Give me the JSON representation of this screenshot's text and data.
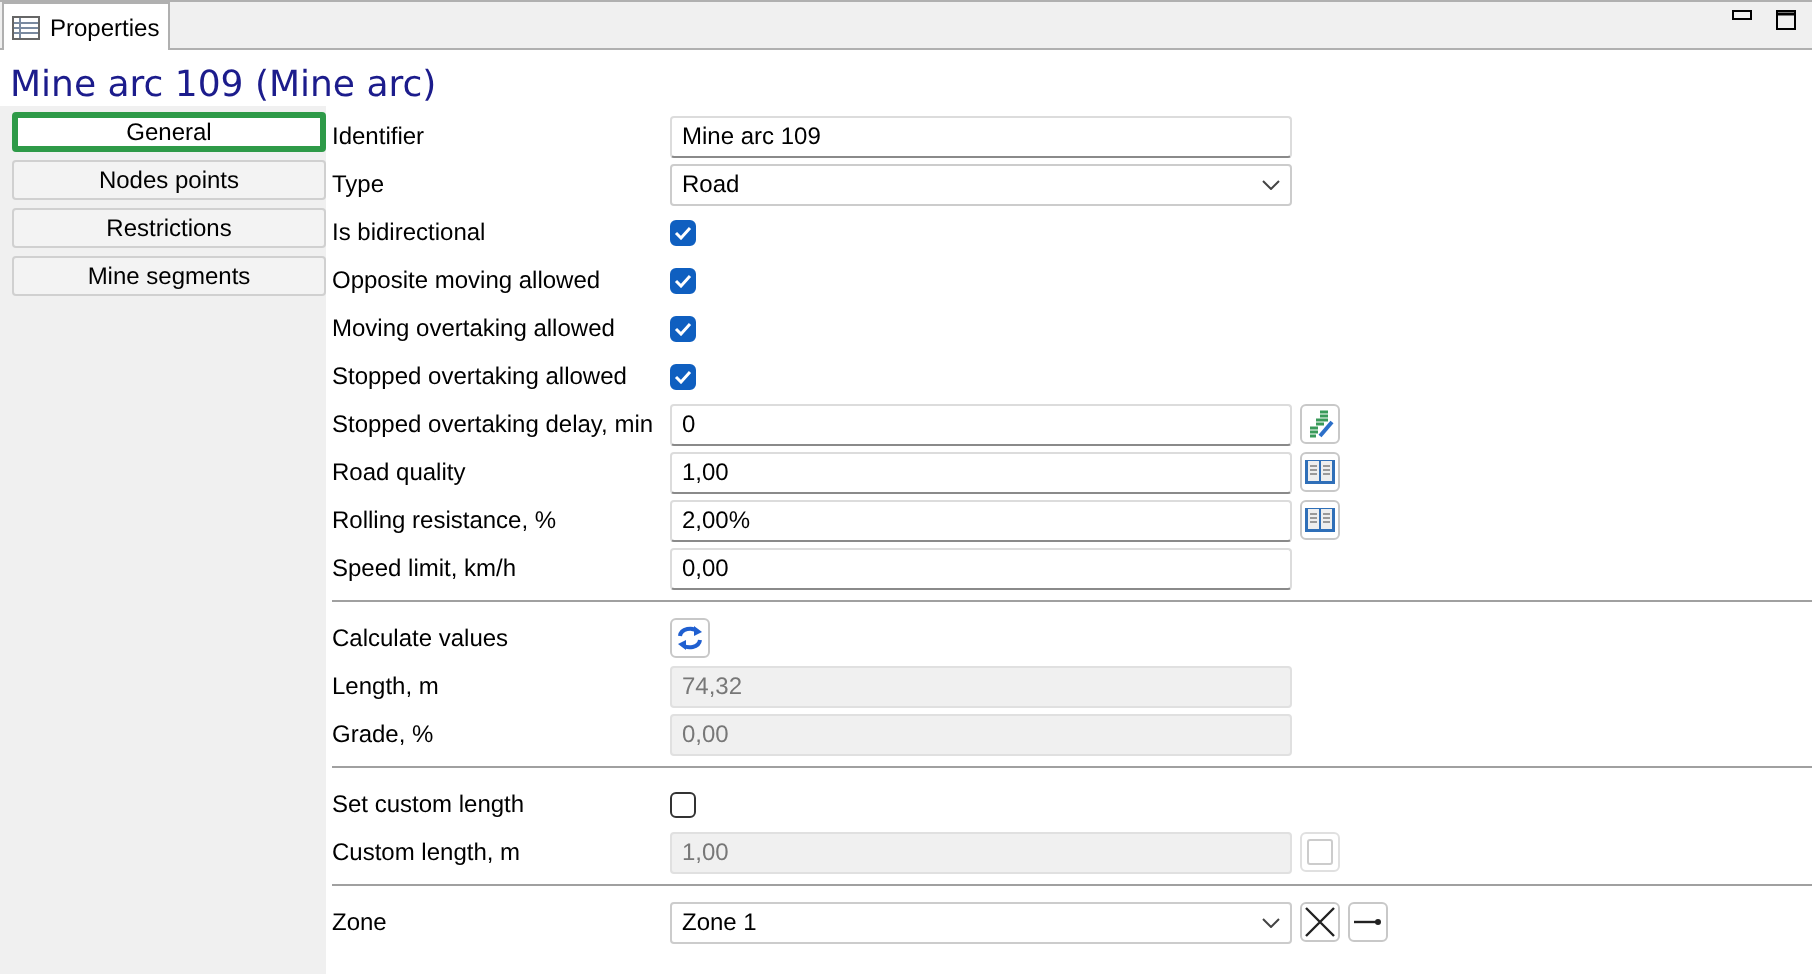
{
  "panel_tab": {
    "label": "Properties"
  },
  "title": "Mine arc 109 (Mine arc)",
  "nav": [
    {
      "label": "General",
      "selected": true
    },
    {
      "label": "Nodes  points",
      "selected": false
    },
    {
      "label": "Restrictions",
      "selected": false
    },
    {
      "label": "Mine segments",
      "selected": false
    }
  ],
  "groups": [
    {
      "rows": [
        {
          "label": "Identifier",
          "kind": "text",
          "value": "Mine arc 109"
        },
        {
          "label": "Type",
          "kind": "select",
          "value": "Road"
        },
        {
          "label": "Is bidirectional",
          "kind": "checkbox",
          "checked": true
        },
        {
          "label": "Opposite moving allowed",
          "kind": "checkbox",
          "checked": true
        },
        {
          "label": "Moving overtaking allowed",
          "kind": "checkbox",
          "checked": true
        },
        {
          "label": "Stopped overtaking allowed",
          "kind": "checkbox",
          "checked": true
        },
        {
          "label": "Stopped overtaking delay, min",
          "kind": "text",
          "value": "0",
          "tools": [
            {
              "kind": "edit"
            }
          ]
        },
        {
          "label": "Road quality",
          "kind": "text",
          "value": "1,00",
          "tools": [
            {
              "kind": "book"
            }
          ]
        },
        {
          "label": "Rolling resistance, %",
          "kind": "text",
          "value": "2,00%",
          "tools": [
            {
              "kind": "book"
            }
          ]
        },
        {
          "label": "Speed limit, km/h",
          "kind": "text",
          "value": "0,00"
        }
      ]
    },
    {
      "rows": [
        {
          "label": "Calculate values",
          "kind": "button"
        },
        {
          "label": "Length, m",
          "kind": "text",
          "value": "74,32",
          "disabled": true
        },
        {
          "label": "Grade, %",
          "kind": "text",
          "value": "0,00",
          "disabled": true
        }
      ]
    },
    {
      "rows": [
        {
          "label": "Set custom length",
          "kind": "checkbox",
          "checked": false
        },
        {
          "label": "Custom length, m",
          "kind": "text",
          "value": "1,00",
          "disabled": true,
          "tools": [
            {
              "kind": "blank"
            }
          ]
        }
      ]
    },
    {
      "rows": [
        {
          "label": "Zone",
          "kind": "select",
          "value": "Zone 1",
          "tools": [
            {
              "kind": "clear"
            },
            {
              "kind": "go"
            }
          ]
        }
      ]
    }
  ]
}
